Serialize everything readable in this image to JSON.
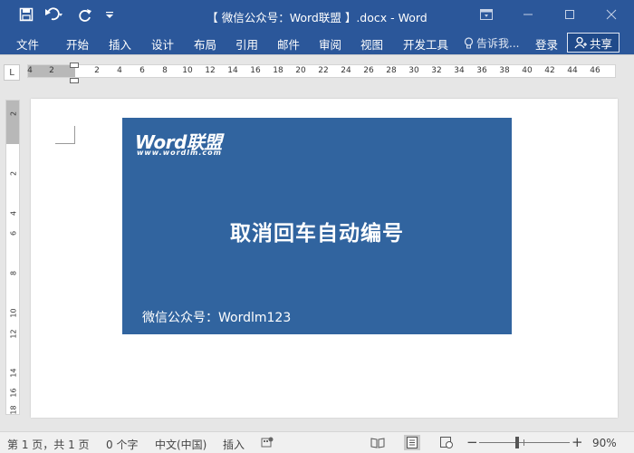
{
  "window": {
    "title": "【 微信公众号：Word联盟 】.docx - Word"
  },
  "quick_access": {
    "save_icon": "save-icon",
    "undo_icon": "undo-icon",
    "redo_icon": "redo-icon",
    "customize_icon": "customize-qat-icon"
  },
  "ribbon": {
    "tabs": [
      "文件",
      "开始",
      "插入",
      "设计",
      "布局",
      "引用",
      "邮件",
      "审阅",
      "视图",
      "开发工具"
    ],
    "tell_me": "告诉我...",
    "login": "登录",
    "share": "共享"
  },
  "ruler": {
    "tab_selector": "L",
    "h_numbers": [
      "4",
      "2",
      "2",
      "4",
      "6",
      "8",
      "10",
      "12",
      "14",
      "16",
      "18",
      "20",
      "22",
      "24",
      "26",
      "28",
      "30",
      "32",
      "34",
      "36",
      "38",
      "40",
      "42",
      "44",
      "46"
    ],
    "v_numbers": [
      "2",
      "2",
      "4",
      "6",
      "8",
      "10",
      "12",
      "14",
      "16",
      "18"
    ]
  },
  "document": {
    "banner": {
      "logo": "Word联盟",
      "logo_url": "www.wordlm.com",
      "headline": "取消回车自动编号",
      "wechat": "微信公众号：Wordlm123",
      "background": "#31649f"
    }
  },
  "statusbar": {
    "page": "第 1 页，共 1 页",
    "words": "0 个字",
    "language": "中文(中国)",
    "mode": "插入",
    "zoom_out": "−",
    "zoom_in": "+",
    "zoom": "90%"
  },
  "colors": {
    "accent": "#2b579a",
    "banner": "#31649f"
  }
}
